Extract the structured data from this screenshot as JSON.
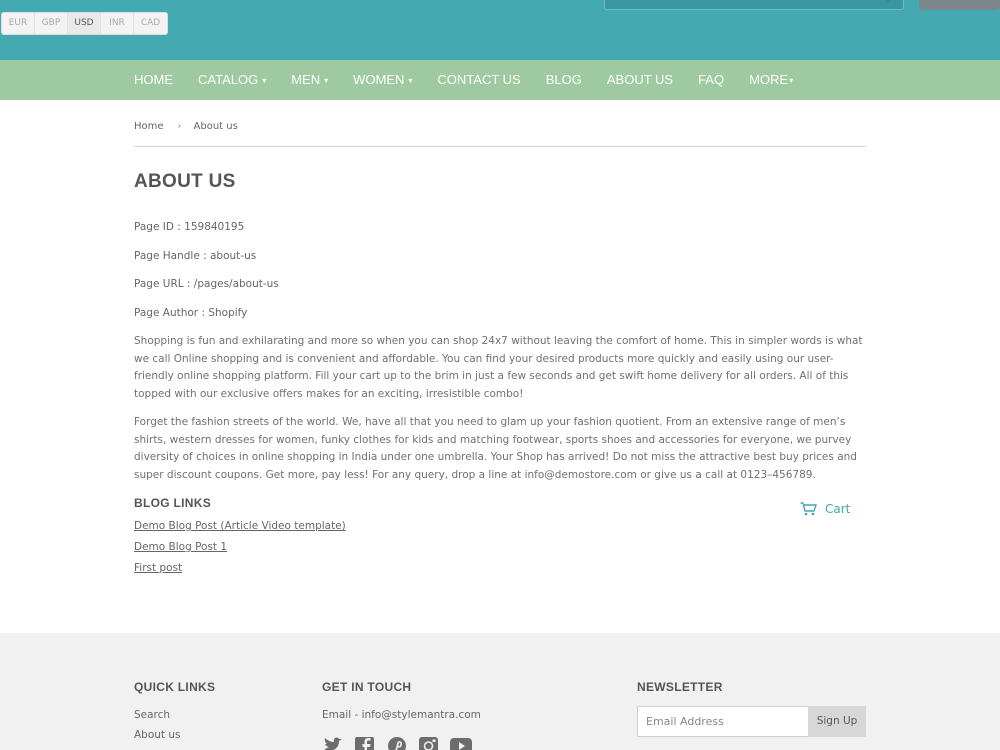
{
  "currencies": [
    {
      "code": "EUR",
      "active": false
    },
    {
      "code": "GBP",
      "active": false
    },
    {
      "code": "USD",
      "active": true
    },
    {
      "code": "INR",
      "active": false
    },
    {
      "code": "CAD",
      "active": false
    }
  ],
  "colors": {
    "header": "#45a9b2",
    "nav": "#9fc9a0",
    "accent": "#45a9b2",
    "footer": "#f1f1f1"
  },
  "nav": {
    "items": [
      {
        "label": "HOME",
        "dropdown": false
      },
      {
        "label": "CATALOG",
        "dropdown": true
      },
      {
        "label": "MEN",
        "dropdown": true
      },
      {
        "label": "WOMEN",
        "dropdown": true
      },
      {
        "label": "CONTACT US",
        "dropdown": false
      },
      {
        "label": "BLOG",
        "dropdown": false
      },
      {
        "label": "ABOUT US",
        "dropdown": false
      },
      {
        "label": "FAQ",
        "dropdown": false
      },
      {
        "label": "MORE",
        "dropdown": true
      }
    ]
  },
  "breadcrumb": {
    "home": "Home",
    "separator": "›",
    "current": "About us"
  },
  "page": {
    "title": "ABOUT US",
    "meta": {
      "id": "Page ID : 159840195",
      "handle": "Page Handle : about-us",
      "url": "Page URL : /pages/about-us",
      "author": "Page Author : Shopify"
    },
    "paragraph1": "Shopping is fun and exhilarating and more so when you can shop 24x7 without leaving the comfort of home. This in simpler words is what we call Online shopping and is convenient and affordable. You can find your desired products more quickly and easily using our user-friendly online shopping platform. Fill your cart up to the brim in just a few seconds and get swift home delivery for all orders. All of this topped with our exclusive offers makes for an exciting, irresistible combo!",
    "paragraph2": "Forget the fashion streets of the world. We,  have all that you need to glam up your fashion quotient. From an extensive range of men’s shirts, western dresses for women, funky clothes for kids and matching footwear, sports shoes and accessories for everyone, we purvey diversity of choices in online shopping in India under one umbrella. Your  Shop has arrived! Do not miss the attractive best buy prices and super discount coupons. Get more, pay less! For any query, drop a line at info@demostore.com or give us a call at 0123–456789."
  },
  "blog": {
    "heading": "BLOG LINKS",
    "links": [
      "Demo Blog Post (Article Video template)",
      "Demo Blog Post 1",
      "First post"
    ]
  },
  "cart": {
    "label": "Cart",
    "icon": "cart-icon"
  },
  "footer": {
    "quick_links": {
      "heading": "QUICK LINKS",
      "links": [
        "Search",
        "About us"
      ]
    },
    "get_in_touch": {
      "heading": "GET IN TOUCH",
      "email": "Email - info@stylemantra.com",
      "social": [
        "twitter-icon",
        "facebook-icon",
        "pinterest-icon",
        "instagram-icon",
        "youtube-icon"
      ]
    },
    "newsletter": {
      "heading": "NEWSLETTER",
      "placeholder": "Email Address",
      "button": "Sign Up"
    }
  }
}
